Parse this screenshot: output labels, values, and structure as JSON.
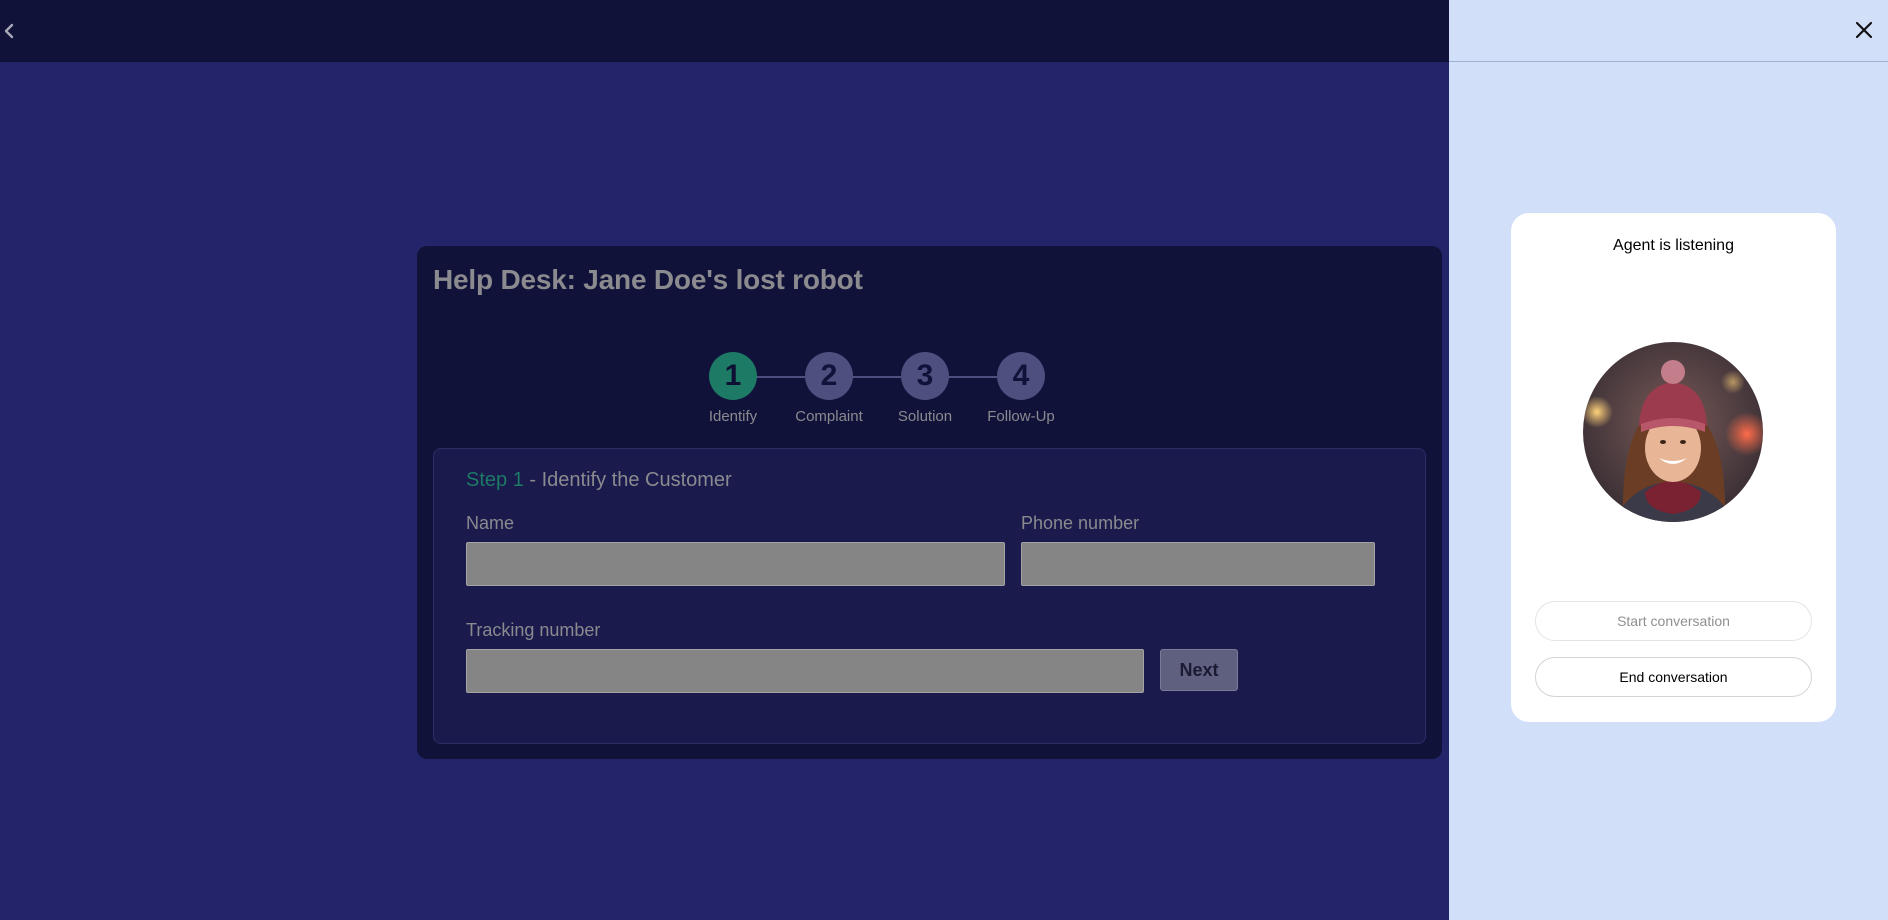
{
  "colors": {
    "main_bg": "#24246a",
    "topbar_bg": "#11123a",
    "card_bg": "#11123a",
    "accent": "#1c7a65",
    "panel_bg": "#d1dff9"
  },
  "topbar": {
    "back_icon": "chevron-left-icon"
  },
  "help_desk": {
    "title": "Help Desk: Jane Doe's lost robot",
    "steps": [
      {
        "number": "1",
        "label": "Identify",
        "active": true
      },
      {
        "number": "2",
        "label": "Complaint",
        "active": false
      },
      {
        "number": "3",
        "label": "Solution",
        "active": false
      },
      {
        "number": "4",
        "label": "Follow-Up",
        "active": false
      }
    ],
    "step_heading": {
      "prefix": "Step 1",
      "text": " - Identify the Customer"
    },
    "fields": {
      "name_label": "Name",
      "name_value": "",
      "phone_label": "Phone number",
      "phone_value": "",
      "tracking_label": "Tracking number",
      "tracking_value": ""
    },
    "next_label": "Next"
  },
  "agent_panel": {
    "close_icon": "close-icon",
    "status": "Agent is listening",
    "avatar_icon": "agent-avatar",
    "start_label": "Start conversation",
    "end_label": "End conversation"
  }
}
